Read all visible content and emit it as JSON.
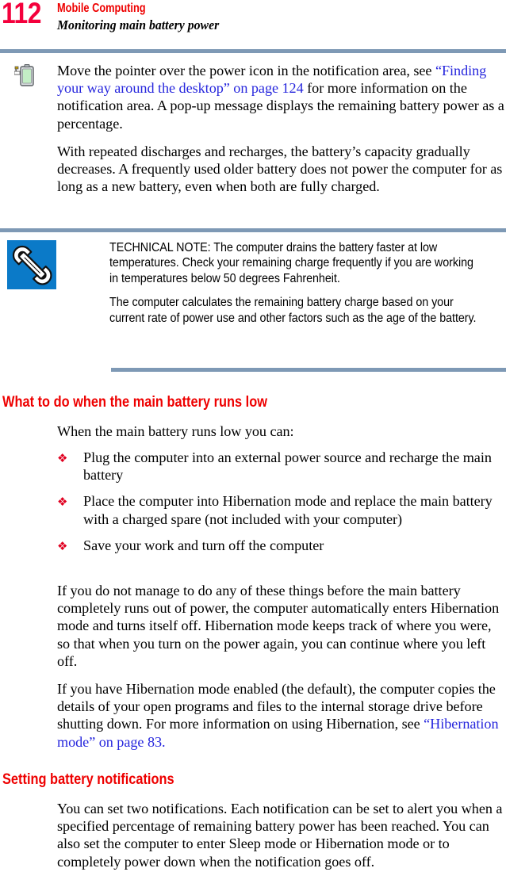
{
  "header": {
    "page_number": "112",
    "chapter": "Mobile Computing",
    "section": "Monitoring main battery power",
    "folio_color": "#f4003c",
    "chapter_color": "#ee0000",
    "rule_color": "#7e99b5"
  },
  "icons": {
    "power": "battery-power-icon",
    "technical_note": "wrench-icon",
    "bullet": "❖"
  },
  "intro": {
    "paragraph_1_part_1": "Move the pointer over the power icon in the notification area, see ",
    "paragraph_1_link": "“Finding your way around the desktop” on page 124",
    "paragraph_1_part_2": " for more information on the notification area. A pop-up message displays the remaining battery power as a percentage.",
    "paragraph_2": "With repeated discharges and recharges, the battery’s capacity gradually decreases. A frequently used older battery does not power the computer for as long as a new battery, even when both are fully charged."
  },
  "technical_note": {
    "paragraph_1": "TECHNICAL NOTE: The computer drains the battery faster at low temperatures. Check your remaining charge frequently if you are working in temperatures below 50 degrees Fahrenheit.",
    "paragraph_2": "The computer calculates the remaining battery charge based on your current rate of power use and other factors such as the age of the battery.",
    "icon_background": "#0b7ac8"
  },
  "section_what_to_do": {
    "heading": "What to do when the main battery runs low",
    "intro": "When the main battery runs low you can:",
    "bullets": [
      "Plug the computer into an external power source and recharge the main battery",
      "Place the computer into Hibernation mode and replace the main battery with a charged spare (not included with your computer)",
      "Save your work and turn off the computer"
    ],
    "paragraph_1": "If you do not manage to do any of these things before the main battery completely runs out of power, the computer automatically enters Hibernation mode and turns itself off. Hibernation mode keeps track of where you were, so that when you turn on the power again, you can continue where you left off.",
    "paragraph_2_part_1": "If you have Hibernation mode enabled (the default), the computer copies the details of your open programs and files to the internal storage drive before shutting down. For more information on using Hibernation, see ",
    "paragraph_2_link": "“Hibernation mode” on page 83.",
    "link_color": "#2626dd"
  },
  "section_setting_notifications": {
    "heading": "Setting battery notifications",
    "paragraph_1": "You can set two notifications. Each notification can be set to alert you when a specified percentage of remaining battery power has been reached. You can also set the computer to enter Sleep mode or Hibernation mode or to completely power down when the notification goes off."
  }
}
